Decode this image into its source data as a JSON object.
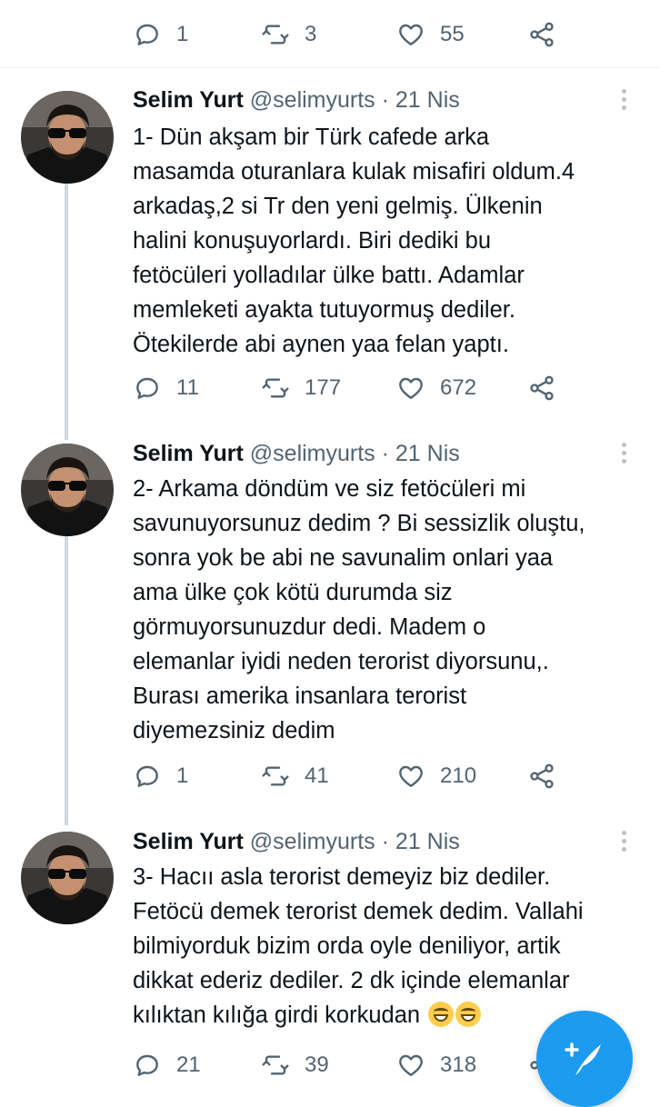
{
  "top_actions": {
    "reply_count": "1",
    "retweet_count": "3",
    "like_count": "55"
  },
  "tweets": [
    {
      "name": "Selim Yurt",
      "handle": "@selimyurts",
      "separator": "·",
      "date": "21 Nis",
      "text": "1- Dün akşam bir Türk cafede arka\nmasamda oturanlara kulak misafiri oldum.4\narkadaş,2 si Tr den yeni gelmiş. Ülkenin\nhalini konuşuyorlardı. Biri dediki bu\nfetöcüleri yolladılar ülke battı. Adamlar\nmemleketi ayakta tutuyormuş dediler.\nÖtekilerde abi aynen yaa felan yaptı.",
      "replies": "11",
      "retweets": "177",
      "likes": "672"
    },
    {
      "name": "Selim Yurt",
      "handle": "@selimyurts",
      "separator": "·",
      "date": "21 Nis",
      "text": "2- Arkama döndüm ve siz fetöcüleri mi\nsavunuyorsunuz dedim ? Bi sessizlik oluştu,\nsonra yok be abi ne savunalim onlari yaa\nama ülke çok kötü durumda siz\ngörmuyorsunuzdur dedi. Madem o\nelemanlar iyidi neden terorist diyorsunu,.\nBurası amerika insanlara terorist\ndiyemezsiniz dedim",
      "replies": "1",
      "retweets": "41",
      "likes": "210"
    },
    {
      "name": "Selim Yurt",
      "handle": "@selimyurts",
      "separator": "·",
      "date": "21 Nis",
      "text": "3- Hacıı asla terorist demeyiz biz dediler.\nFetöcü demek terorist demek dedim. Vallahi\nbilmiyorduk bizim orda oyle deniliyor, artik\ndikkat ederiz dediler. 2 dk içinde elemanlar\nkılıktan kılığa girdi korkudan",
      "replies": "21",
      "retweets": "39",
      "likes": "318"
    }
  ],
  "icons": {
    "reply": "reply-icon",
    "retweet": "retweet-icon",
    "like": "like-icon",
    "share": "share-icon",
    "more": "more-icon",
    "compose": "compose-tweet-icon",
    "emoji": "grinning-face-emoji"
  },
  "colors": {
    "accent": "#1d9bf0",
    "text": "#0f1419",
    "muted": "#536471",
    "thread_line": "#cfd9de"
  }
}
